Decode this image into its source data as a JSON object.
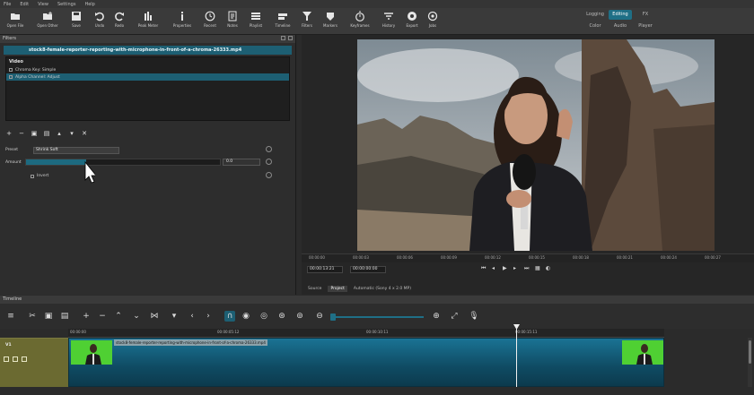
{
  "menu": [
    "File",
    "Edit",
    "View",
    "Settings",
    "Help"
  ],
  "toolbar": [
    {
      "label": "Open File",
      "icon": "folder-open-icon"
    },
    {
      "label": "Open Other",
      "icon": "open-other-icon"
    },
    {
      "label": "Save",
      "icon": "save-icon"
    },
    {
      "label": "Undo",
      "icon": "undo-icon"
    },
    {
      "label": "Redo",
      "icon": "redo-icon"
    },
    {
      "label": "Peak Meter",
      "icon": "peak-meter-icon"
    },
    {
      "label": "Properties",
      "icon": "info-icon"
    },
    {
      "label": "Recent",
      "icon": "clock-icon"
    },
    {
      "label": "Notes",
      "icon": "notes-icon"
    },
    {
      "label": "Playlist",
      "icon": "playlist-icon"
    },
    {
      "label": "Timeline",
      "icon": "timeline-icon"
    },
    {
      "label": "Filters",
      "icon": "filter-icon"
    },
    {
      "label": "Markers",
      "icon": "marker-icon"
    },
    {
      "label": "Keyframes",
      "icon": "stopwatch-icon"
    },
    {
      "label": "History",
      "icon": "history-icon"
    },
    {
      "label": "Export",
      "icon": "export-icon"
    },
    {
      "label": "Jobs",
      "icon": "jobs-icon"
    }
  ],
  "workspaces": [
    {
      "label": "Logging",
      "active": false
    },
    {
      "label": "Editing",
      "active": true
    },
    {
      "label": "FX",
      "active": false
    },
    {
      "label": "Color",
      "active": false
    },
    {
      "label": "Audio",
      "active": false
    },
    {
      "label": "Player",
      "active": false
    }
  ],
  "filters_panel": {
    "title": "Filters",
    "clip_name": "stock8-female-reporter-reporting-with-microphone-in-front-of-a-chroma-26333.mp4",
    "category": "Video",
    "items": [
      {
        "label": "Chroma Key: Simple",
        "selected": false
      },
      {
        "label": "Alpha Channel: Adjust",
        "selected": true
      }
    ],
    "preset_label": "Preset",
    "preset_value": "Shrink Soft",
    "amount_label": "Amount",
    "amount_value": "0.0",
    "amount_fraction": 0.31,
    "invert_label": "Invert"
  },
  "viewer": {
    "ticks": [
      "00:00:00",
      "00:00:03",
      "00:00:06",
      "00:00:09",
      "00:00:12",
      "00:00:15",
      "00:00:18",
      "00:00:21",
      "00:00:24",
      "00:00:27"
    ],
    "current_time": "00:00:13:21",
    "total_time": "00:00:00:00",
    "source_tabs": [
      {
        "label": "Source",
        "active": false
      },
      {
        "label": "Project",
        "active": true
      }
    ],
    "profile": "Automatic (Sony 4 x 2.0 MP)"
  },
  "timeline": {
    "title": "Timeline",
    "ruler_ticks": [
      "00:00:00",
      "00:00:05:12",
      "00:00:10:11",
      "00:00:15:11"
    ],
    "track_label": "V1",
    "clip_name": "stock8-female-reporter-reporting-with-microphone-in-front-of-a-chroma-26333.mp4"
  },
  "colors": {
    "accent": "#1d5f73",
    "track_header": "#6b6a31",
    "chroma_green": "#4fd033"
  }
}
